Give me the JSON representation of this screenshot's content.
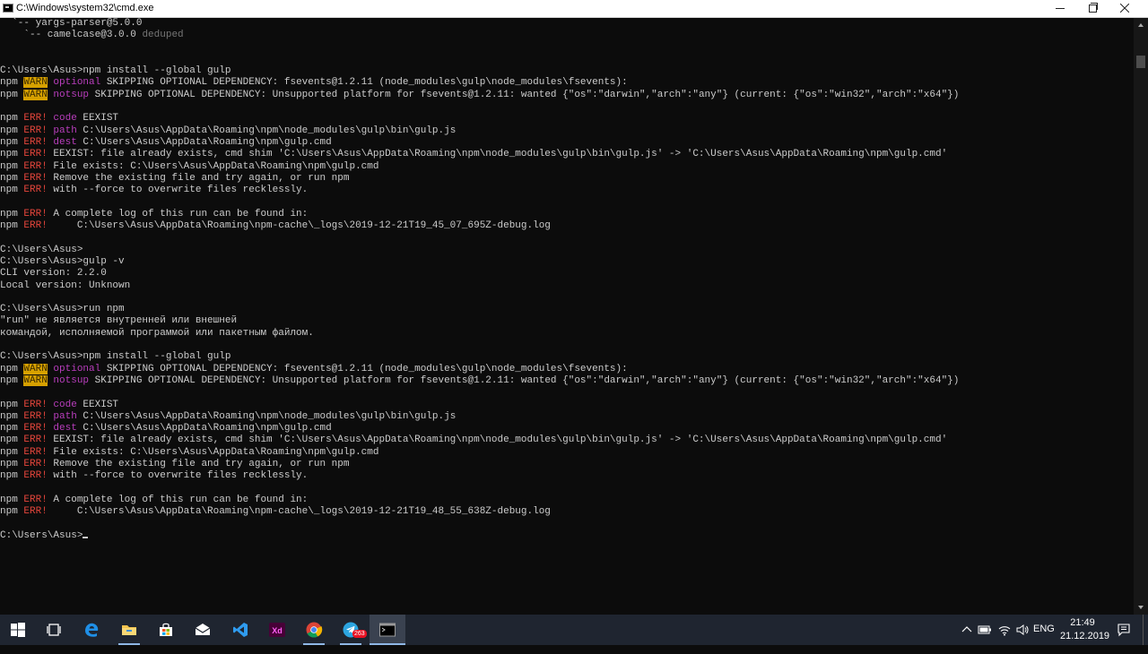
{
  "window": {
    "title": "C:\\Windows\\system32\\cmd.exe"
  },
  "console": {
    "lines": [
      [
        {
          "t": "  `-- yargs-parser@5.0.0"
        }
      ],
      [
        {
          "t": "    `-- camelcase@3.0.0 "
        },
        {
          "t": "deduped",
          "c": "dim"
        }
      ],
      [
        {
          "t": ""
        }
      ],
      [
        {
          "t": ""
        }
      ],
      [
        {
          "t": "C:\\Users\\Asus>npm install --global gulp"
        }
      ],
      [
        {
          "t": "npm "
        },
        {
          "t": "WARN",
          "c": "warn"
        },
        {
          "t": " "
        },
        {
          "t": "optional",
          "c": "kw"
        },
        {
          "t": " SKIPPING OPTIONAL DEPENDENCY: fsevents@1.2.11 (node_modules\\gulp\\node_modules\\fsevents):"
        }
      ],
      [
        {
          "t": "npm "
        },
        {
          "t": "WARN",
          "c": "warn"
        },
        {
          "t": " "
        },
        {
          "t": "notsup",
          "c": "kw"
        },
        {
          "t": " SKIPPING OPTIONAL DEPENDENCY: Unsupported platform for fsevents@1.2.11: wanted {\"os\":\"darwin\",\"arch\":\"any\"} (current: {\"os\":\"win32\",\"arch\":\"x64\"})"
        }
      ],
      [
        {
          "t": ""
        }
      ],
      [
        {
          "t": "npm "
        },
        {
          "t": "ERR!",
          "c": "err"
        },
        {
          "t": " "
        },
        {
          "t": "code",
          "c": "kw"
        },
        {
          "t": " EEXIST"
        }
      ],
      [
        {
          "t": "npm "
        },
        {
          "t": "ERR!",
          "c": "err"
        },
        {
          "t": " "
        },
        {
          "t": "path",
          "c": "kw"
        },
        {
          "t": " C:\\Users\\Asus\\AppData\\Roaming\\npm\\node_modules\\gulp\\bin\\gulp.js"
        }
      ],
      [
        {
          "t": "npm "
        },
        {
          "t": "ERR!",
          "c": "err"
        },
        {
          "t": " "
        },
        {
          "t": "dest",
          "c": "kw"
        },
        {
          "t": " C:\\Users\\Asus\\AppData\\Roaming\\npm\\gulp.cmd"
        }
      ],
      [
        {
          "t": "npm "
        },
        {
          "t": "ERR!",
          "c": "err"
        },
        {
          "t": " EEXIST: file already exists, cmd shim 'C:\\Users\\Asus\\AppData\\Roaming\\npm\\node_modules\\gulp\\bin\\gulp.js' -> 'C:\\Users\\Asus\\AppData\\Roaming\\npm\\gulp.cmd'"
        }
      ],
      [
        {
          "t": "npm "
        },
        {
          "t": "ERR!",
          "c": "err"
        },
        {
          "t": " File exists: C:\\Users\\Asus\\AppData\\Roaming\\npm\\gulp.cmd"
        }
      ],
      [
        {
          "t": "npm "
        },
        {
          "t": "ERR!",
          "c": "err"
        },
        {
          "t": " Remove the existing file and try again, or run npm"
        }
      ],
      [
        {
          "t": "npm "
        },
        {
          "t": "ERR!",
          "c": "err"
        },
        {
          "t": " with --force to overwrite files recklessly."
        }
      ],
      [
        {
          "t": ""
        }
      ],
      [
        {
          "t": "npm "
        },
        {
          "t": "ERR!",
          "c": "err"
        },
        {
          "t": " A complete log of this run can be found in:"
        }
      ],
      [
        {
          "t": "npm "
        },
        {
          "t": "ERR!",
          "c": "err"
        },
        {
          "t": "     C:\\Users\\Asus\\AppData\\Roaming\\npm-cache\\_logs\\2019-12-21T19_45_07_695Z-debug.log"
        }
      ],
      [
        {
          "t": ""
        }
      ],
      [
        {
          "t": "C:\\Users\\Asus>"
        }
      ],
      [
        {
          "t": "C:\\Users\\Asus>gulp -v"
        }
      ],
      [
        {
          "t": "CLI version: 2.2.0"
        }
      ],
      [
        {
          "t": "Local version: Unknown"
        }
      ],
      [
        {
          "t": ""
        }
      ],
      [
        {
          "t": "C:\\Users\\Asus>run npm"
        }
      ],
      [
        {
          "t": "\"run\" не является внутренней или внешней"
        }
      ],
      [
        {
          "t": "командой, исполняемой программой или пакетным файлом."
        }
      ],
      [
        {
          "t": ""
        }
      ],
      [
        {
          "t": "C:\\Users\\Asus>npm install --global gulp"
        }
      ],
      [
        {
          "t": "npm "
        },
        {
          "t": "WARN",
          "c": "warn"
        },
        {
          "t": " "
        },
        {
          "t": "optional",
          "c": "kw"
        },
        {
          "t": " SKIPPING OPTIONAL DEPENDENCY: fsevents@1.2.11 (node_modules\\gulp\\node_modules\\fsevents):"
        }
      ],
      [
        {
          "t": "npm "
        },
        {
          "t": "WARN",
          "c": "warn"
        },
        {
          "t": " "
        },
        {
          "t": "notsup",
          "c": "kw"
        },
        {
          "t": " SKIPPING OPTIONAL DEPENDENCY: Unsupported platform for fsevents@1.2.11: wanted {\"os\":\"darwin\",\"arch\":\"any\"} (current: {\"os\":\"win32\",\"arch\":\"x64\"})"
        }
      ],
      [
        {
          "t": ""
        }
      ],
      [
        {
          "t": "npm "
        },
        {
          "t": "ERR!",
          "c": "err"
        },
        {
          "t": " "
        },
        {
          "t": "code",
          "c": "kw"
        },
        {
          "t": " EEXIST"
        }
      ],
      [
        {
          "t": "npm "
        },
        {
          "t": "ERR!",
          "c": "err"
        },
        {
          "t": " "
        },
        {
          "t": "path",
          "c": "kw"
        },
        {
          "t": " C:\\Users\\Asus\\AppData\\Roaming\\npm\\node_modules\\gulp\\bin\\gulp.js"
        }
      ],
      [
        {
          "t": "npm "
        },
        {
          "t": "ERR!",
          "c": "err"
        },
        {
          "t": " "
        },
        {
          "t": "dest",
          "c": "kw"
        },
        {
          "t": " C:\\Users\\Asus\\AppData\\Roaming\\npm\\gulp.cmd"
        }
      ],
      [
        {
          "t": "npm "
        },
        {
          "t": "ERR!",
          "c": "err"
        },
        {
          "t": " EEXIST: file already exists, cmd shim 'C:\\Users\\Asus\\AppData\\Roaming\\npm\\node_modules\\gulp\\bin\\gulp.js' -> 'C:\\Users\\Asus\\AppData\\Roaming\\npm\\gulp.cmd'"
        }
      ],
      [
        {
          "t": "npm "
        },
        {
          "t": "ERR!",
          "c": "err"
        },
        {
          "t": " File exists: C:\\Users\\Asus\\AppData\\Roaming\\npm\\gulp.cmd"
        }
      ],
      [
        {
          "t": "npm "
        },
        {
          "t": "ERR!",
          "c": "err"
        },
        {
          "t": " Remove the existing file and try again, or run npm"
        }
      ],
      [
        {
          "t": "npm "
        },
        {
          "t": "ERR!",
          "c": "err"
        },
        {
          "t": " with --force to overwrite files recklessly."
        }
      ],
      [
        {
          "t": ""
        }
      ],
      [
        {
          "t": "npm "
        },
        {
          "t": "ERR!",
          "c": "err"
        },
        {
          "t": " A complete log of this run can be found in:"
        }
      ],
      [
        {
          "t": "npm "
        },
        {
          "t": "ERR!",
          "c": "err"
        },
        {
          "t": "     C:\\Users\\Asus\\AppData\\Roaming\\npm-cache\\_logs\\2019-12-21T19_48_55_638Z-debug.log"
        }
      ],
      [
        {
          "t": ""
        }
      ],
      [
        {
          "t": "C:\\Users\\Asus>"
        },
        {
          "t": "",
          "c": "cursor"
        }
      ]
    ]
  },
  "colors": {
    "background": "#0c0c0c",
    "text": "#cccccc",
    "warn_bg": "#d7a100",
    "err": "#e5453b",
    "keyword": "#b93ebd",
    "taskbar": "#1f2530"
  },
  "taskbar": {
    "apps": [
      {
        "name": "start-button",
        "icon": "windows-logo-icon"
      },
      {
        "name": "task-view-button",
        "icon": "task-view-icon"
      },
      {
        "name": "edge-button",
        "icon": "edge-icon"
      },
      {
        "name": "file-explorer-button",
        "icon": "folder-icon"
      },
      {
        "name": "store-button",
        "icon": "store-icon"
      },
      {
        "name": "mail-button",
        "icon": "mail-icon"
      },
      {
        "name": "vscode-button",
        "icon": "vscode-icon"
      },
      {
        "name": "adobe-xd-button",
        "icon": "xd-icon",
        "label": "Xd"
      },
      {
        "name": "chrome-button",
        "icon": "chrome-icon"
      },
      {
        "name": "telegram-button",
        "icon": "telegram-icon",
        "badge": "263"
      },
      {
        "name": "cmd-button",
        "icon": "cmd-icon"
      }
    ],
    "tray": {
      "language": "ENG",
      "time": "21:49",
      "date": "21.12.2019"
    }
  }
}
